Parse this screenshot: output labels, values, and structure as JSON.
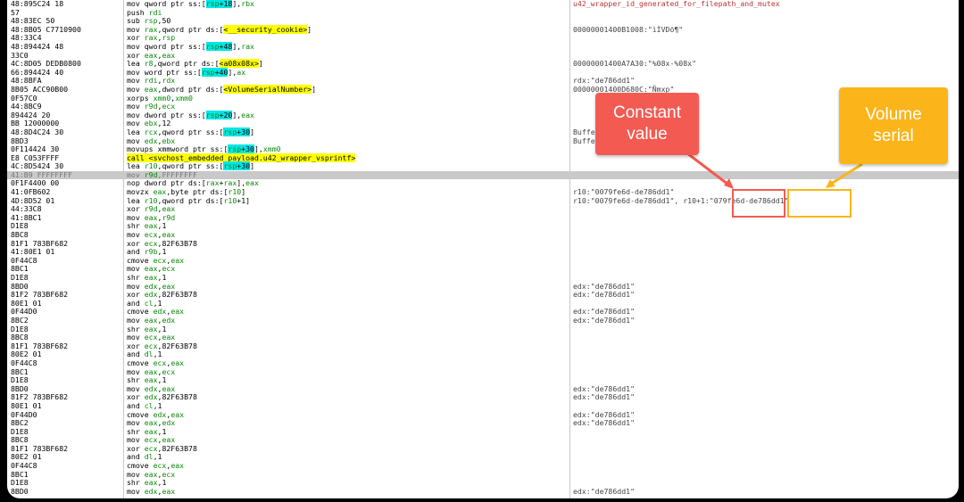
{
  "annotations": {
    "constant_label": "Constant value",
    "volume_label": "Volume serial",
    "colors": {
      "red": "#f35b52",
      "orange": "#fbb51a"
    }
  },
  "rows": [
    {
      "bytes": "48:895C24 18",
      "dis": "mov qword ptr ss:[rsp+18],rbx",
      "cmt": "u42_wrapper_id_generated_for_filepath_and_mutex"
    },
    {
      "bytes": "57",
      "dis": "push rdi",
      "cmt": ""
    },
    {
      "bytes": "48:83EC 50",
      "dis": "sub rsp,50",
      "cmt": ""
    },
    {
      "bytes": "48:8B05 C7710900",
      "dis": "mov rax,qword ptr ds:[<__security_cookie>]",
      "cmt": "00000001400B1008:\"ìÌVDö¶\""
    },
    {
      "bytes": "48:33C4",
      "dis": "xor rax,rsp",
      "cmt": ""
    },
    {
      "bytes": "48:894424 48",
      "dis": "mov qword ptr ss:[rsp+48],rax",
      "cmt": ""
    },
    {
      "bytes": "33C0",
      "dis": "xor eax,eax",
      "cmt": ""
    },
    {
      "bytes": "4C:8D05 DEDB0800",
      "dis": "lea r8,qword ptr ds:[<a08x08x>]",
      "cmt": "00000001400A7A30:\"%08x-%08x\""
    },
    {
      "bytes": "66:894424 40",
      "dis": "mov word ptr ss:[rsp+40],ax",
      "cmt": ""
    },
    {
      "bytes": "48:8BFA",
      "dis": "mov rdi,rdx",
      "cmt": "rdx:\"de786dd1\""
    },
    {
      "bytes": "8B05 ACC90B00",
      "dis": "mov eax,dword ptr ds:[<VolumeSerialNumber>]",
      "cmt": "00000001400D680C:\"Ñmxp\""
    },
    {
      "bytes": "0F57C0",
      "dis": "xorps xmm0,xmm0",
      "cmt": ""
    },
    {
      "bytes": "44:8BC9",
      "dis": "mov r9d,ecx",
      "cmt": ""
    },
    {
      "bytes": "894424 20",
      "dis": "mov dword ptr ss:[rsp+20],eax",
      "cmt": ""
    },
    {
      "bytes": "BB 12000000",
      "dis": "mov ebx,12",
      "cmt": ""
    },
    {
      "bytes": "48:8D4C24 30",
      "dis": "lea rcx,qword ptr ss:[rsp+30]",
      "cmt": "Buffer"
    },
    {
      "bytes": "8BD3",
      "dis": "mov edx,ebx",
      "cmt": "Buffer"
    },
    {
      "bytes": "0F114424 30",
      "dis": "movups xmmword ptr ss:[rsp+30],xmm0",
      "cmt": ""
    },
    {
      "bytes": "E8 C053FFFF",
      "dis": "call <svchost_embedded_payload.u42_wrapper_vsprintf>",
      "cmt": ""
    },
    {
      "bytes": "4C:8D5424 30",
      "dis": "lea r10,qword ptr ss:[rsp+30]",
      "cmt": ""
    },
    {
      "bytes": "41:B9 FFFFFFFF",
      "dis": "mov r9d,FFFFFFFF",
      "cmt": ""
    },
    {
      "bytes": "0F1F4400 00",
      "dis": "nop dword ptr ds:[rax+rax],eax",
      "cmt": ""
    },
    {
      "bytes": "41:0FB602",
      "dis": "movzx eax,byte ptr ds:[r10]",
      "cmt": "r10:\"0079fe6d-de786dd1\""
    },
    {
      "bytes": "4D:8D52 01",
      "dis": "lea r10,qword ptr ds:[r10+1]",
      "cmt": "r10:\"0079fe6d-de786dd1\", r10+1:\"079fe6d-de786dd1\""
    },
    {
      "bytes": "44:33C8",
      "dis": "xor r9d,eax",
      "cmt": ""
    },
    {
      "bytes": "41:8BC1",
      "dis": "mov eax,r9d",
      "cmt": ""
    },
    {
      "bytes": "D1E8",
      "dis": "shr eax,1",
      "cmt": ""
    },
    {
      "bytes": "8BC8",
      "dis": "mov ecx,eax",
      "cmt": ""
    },
    {
      "bytes": "81F1 783BF682",
      "dis": "xor ecx,82F63B78",
      "cmt": ""
    },
    {
      "bytes": "41:80E1 01",
      "dis": "and r9b,1",
      "cmt": ""
    },
    {
      "bytes": "0F44C8",
      "dis": "cmove ecx,eax",
      "cmt": ""
    },
    {
      "bytes": "8BC1",
      "dis": "mov eax,ecx",
      "cmt": ""
    },
    {
      "bytes": "D1E8",
      "dis": "shr eax,1",
      "cmt": ""
    },
    {
      "bytes": "8BD0",
      "dis": "mov edx,eax",
      "cmt": "edx:\"de786dd1\""
    },
    {
      "bytes": "81F2 783BF682",
      "dis": "xor edx,82F63B78",
      "cmt": "edx:\"de786dd1\""
    },
    {
      "bytes": "80E1 01",
      "dis": "and cl,1",
      "cmt": ""
    },
    {
      "bytes": "0F44D0",
      "dis": "cmove edx,eax",
      "cmt": "edx:\"de786dd1\""
    },
    {
      "bytes": "8BC2",
      "dis": "mov eax,edx",
      "cmt": "edx:\"de786dd1\""
    },
    {
      "bytes": "D1E8",
      "dis": "shr eax,1",
      "cmt": ""
    },
    {
      "bytes": "8BC8",
      "dis": "mov ecx,eax",
      "cmt": ""
    },
    {
      "bytes": "81F1 783BF682",
      "dis": "xor ecx,82F63B78",
      "cmt": ""
    },
    {
      "bytes": "80E2 01",
      "dis": "and dl,1",
      "cmt": ""
    },
    {
      "bytes": "0F44C8",
      "dis": "cmove ecx,eax",
      "cmt": ""
    },
    {
      "bytes": "8BC1",
      "dis": "mov eax,ecx",
      "cmt": ""
    },
    {
      "bytes": "D1E8",
      "dis": "shr eax,1",
      "cmt": ""
    },
    {
      "bytes": "8BD0",
      "dis": "mov edx,eax",
      "cmt": "edx:\"de786dd1\""
    },
    {
      "bytes": "81F2 783BF682",
      "dis": "xor edx,82F63B78",
      "cmt": "edx:\"de786dd1\""
    },
    {
      "bytes": "80E1 01",
      "dis": "and cl,1",
      "cmt": ""
    },
    {
      "bytes": "0F44D0",
      "dis": "cmove edx,eax",
      "cmt": "edx:\"de786dd1\""
    },
    {
      "bytes": "8BC2",
      "dis": "mov eax,edx",
      "cmt": "edx:\"de786dd1\""
    },
    {
      "bytes": "D1E8",
      "dis": "shr eax,1",
      "cmt": ""
    },
    {
      "bytes": "8BC8",
      "dis": "mov ecx,eax",
      "cmt": ""
    },
    {
      "bytes": "81F1 783BF682",
      "dis": "xor ecx,82F63B78",
      "cmt": ""
    },
    {
      "bytes": "80E2 01",
      "dis": "and dl,1",
      "cmt": ""
    },
    {
      "bytes": "0F44C8",
      "dis": "cmove ecx,eax",
      "cmt": ""
    },
    {
      "bytes": "8BC1",
      "dis": "mov eax,ecx",
      "cmt": ""
    },
    {
      "bytes": "D1E8",
      "dis": "shr eax,1",
      "cmt": ""
    },
    {
      "bytes": "8BD0",
      "dis": "mov edx,eax",
      "cmt": "edx:\"de786dd1\""
    }
  ],
  "selected_row": 20
}
